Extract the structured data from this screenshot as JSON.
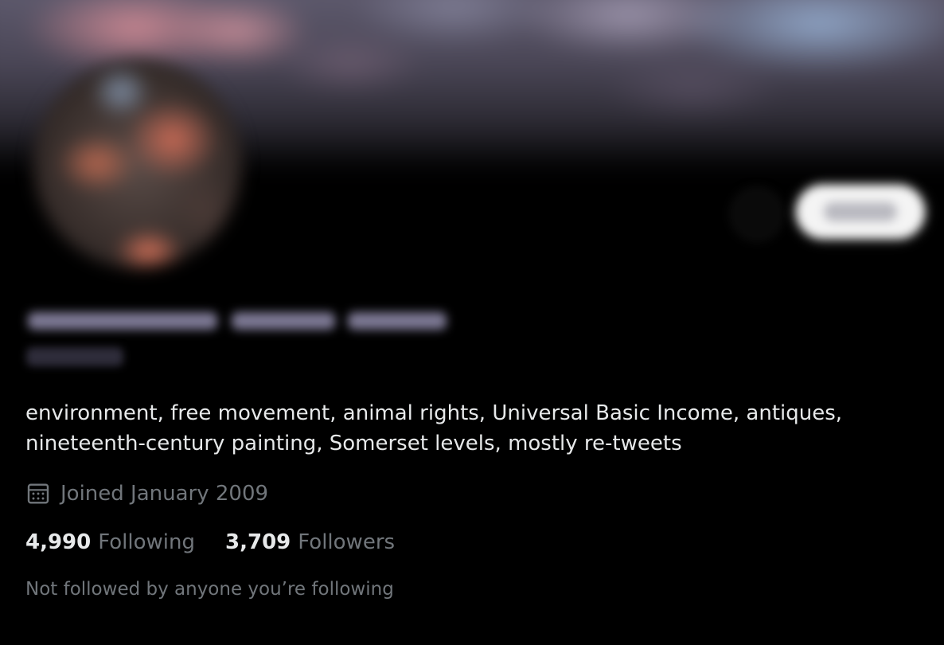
{
  "profile": {
    "bio": "environment, free movement, animal rights, Universal Basic Income, antiques, nineteenth-century painting, Somerset levels, mostly re-tweets",
    "joined_text": "Joined January 2009",
    "following_count": "4,990",
    "following_label": "Following",
    "followers_count": "3,709",
    "followers_label": "Followers",
    "mutual_followers_note": "Not followed by anyone you’re following"
  },
  "icons": {
    "joined": "calendar-icon"
  },
  "colors": {
    "background": "#000000",
    "primary_text": "#e7e9ea",
    "secondary_text": "#71767b"
  }
}
